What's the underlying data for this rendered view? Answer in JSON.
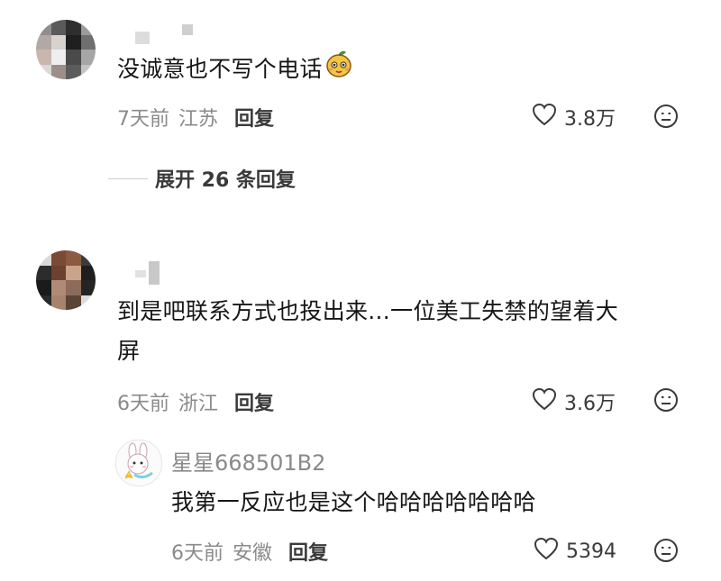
{
  "comments": [
    {
      "text": "没诚意也不写个电话",
      "time": "7天前",
      "location": "江苏",
      "reply_label": "回复",
      "likes": "3.8万",
      "expand_label": "展开 26 条回复"
    },
    {
      "text_line1": "到是吧联系方式也投出来...一位美工失禁的望着大",
      "text_line2": "屏",
      "time": "6天前",
      "location": "浙江",
      "reply_label": "回复",
      "likes": "3.6万"
    }
  ],
  "reply": {
    "username": "星星668501B2",
    "text": "我第一反应也是这个哈哈哈哈哈哈哈",
    "time": "6天前",
    "location": "安徽",
    "reply_label": "回复",
    "likes": "5394"
  },
  "colors": {
    "text_primary": "#161616",
    "text_secondary": "#8a8a8a",
    "icon": "#3a3a3a"
  }
}
